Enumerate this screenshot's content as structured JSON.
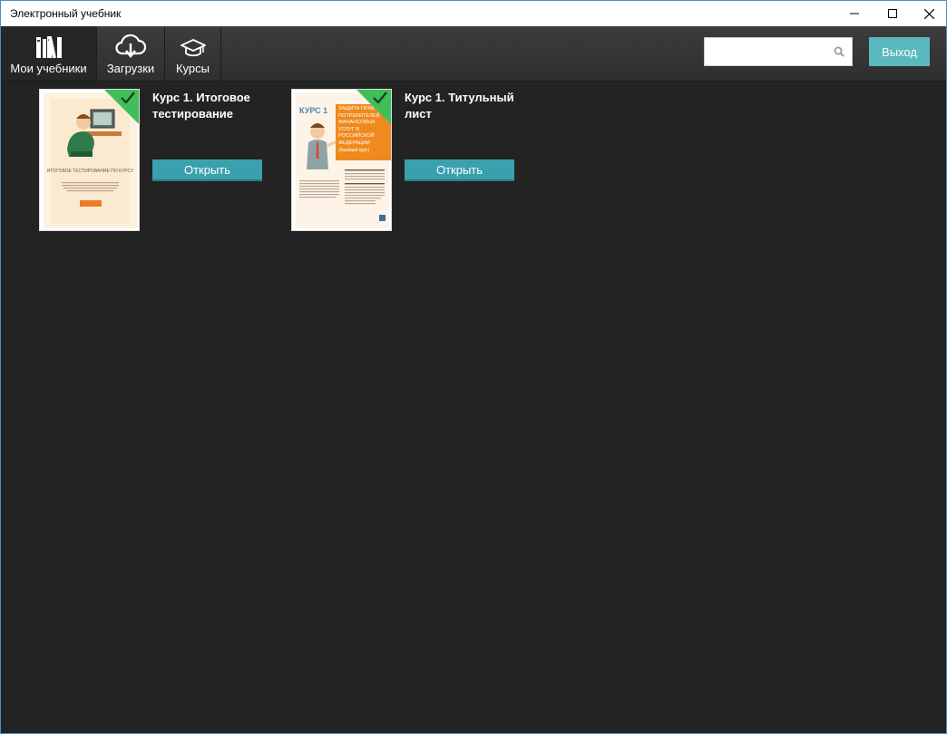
{
  "window": {
    "title": "Электронный учебник"
  },
  "toolbar": {
    "nav": [
      {
        "label": "Мои учебники",
        "icon": "books-icon",
        "active": true
      },
      {
        "label": "Загрузки",
        "icon": "cloud-download-icon",
        "active": false
      },
      {
        "label": "Курсы",
        "icon": "graduation-cap-icon",
        "active": false
      }
    ],
    "search": {
      "value": "",
      "placeholder": "",
      "icon": "search-icon"
    },
    "exit_label": "Выход"
  },
  "books": [
    {
      "title": "Курс 1. Итоговое тестирование",
      "open_label": "Открыть",
      "downloaded": true,
      "cover": {
        "heading": "ИТОГОВОЕ ТЕСТИРОВАНИЕ ПО КУРСУ"
      }
    },
    {
      "title": "Курс 1. Титульный лист",
      "open_label": "Открыть",
      "downloaded": true,
      "cover": {
        "course": "КУРС 1",
        "banner": "ЗАЩИТА ПРАВ ПОТРЕБИТЕЛЕЙ ФИНАНСОВЫХ УСЛУГ В РОССИЙСКОЙ ФЕДЕРАЦИИ",
        "subtitle": "(базовый курс)"
      }
    }
  ],
  "colors": {
    "background": "#232323",
    "accent": "#3aa0ae",
    "exit_button": "#5bb8be",
    "check": "#3fbf5a"
  }
}
